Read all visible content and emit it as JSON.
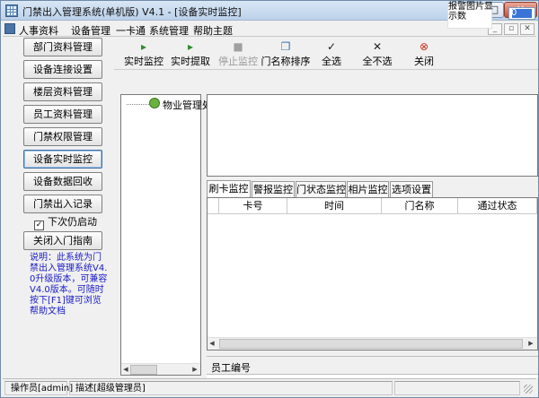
{
  "window": {
    "title": "门禁出入管理系统(单机版)  V4.1 - [设备实时监控]",
    "min_label": "—",
    "max_label": "□",
    "close_label": "✕"
  },
  "menu": {
    "items": [
      "人事资料",
      "设备管理",
      "一卡通",
      "系统管理",
      "帮助主题"
    ],
    "mdi_min": "_",
    "mdi_restore": "▫",
    "mdi_close": "✕"
  },
  "sidebar": {
    "buttons": [
      "部门资料管理",
      "设备连接设置",
      "楼层资料管理",
      "员工资料管理",
      "门禁权限管理",
      "设备实时监控",
      "设备数据回收",
      "门禁出入记录"
    ],
    "checkbox_label": "下次仍启动",
    "checkbox_checked": "✓",
    "guide_button": "关闭入门指南",
    "note": "说明：此系统为门禁出入管理系统V4.0升级版本，可兼容V4.0版本。可随时按下[F1]键可浏览帮助文档"
  },
  "toolbar": {
    "buttons": [
      {
        "label": "实时监控",
        "icon": "play-icon",
        "glyph": "▸"
      },
      {
        "label": "实时提取",
        "icon": "play-icon",
        "glyph": "▸"
      },
      {
        "label": "停止监控",
        "icon": "stop-icon",
        "glyph": "■"
      },
      {
        "label": "门名称排序",
        "icon": "sort-icon",
        "glyph": "❐"
      },
      {
        "label": "全选",
        "icon": "check-icon",
        "glyph": "✓"
      },
      {
        "label": "全不选",
        "icon": "cross-icon",
        "glyph": "✕"
      },
      {
        "label": "关闭",
        "icon": "close-circle-icon",
        "glyph": "⊗"
      }
    ],
    "photo_count_label": "报警图片显示数",
    "photo_count_value": "0"
  },
  "tree": {
    "root_label": "物业管理处"
  },
  "tabs": [
    "刷卡监控",
    "警报监控",
    "门状态监控",
    "相片监控",
    "选项设置"
  ],
  "grid": {
    "columns": [
      "卡号",
      "时间",
      "门名称",
      "通过状态"
    ]
  },
  "employee": {
    "label": "员工编号"
  },
  "statusbar": {
    "operator": "操作员[admin]",
    "description": "描述[超级管理员]"
  },
  "colors": {
    "note_text": "#1a1ac8",
    "close_button": "#c8513b",
    "title_gradient_top": "#d9e7f5",
    "input_highlight": "#3875d7"
  }
}
